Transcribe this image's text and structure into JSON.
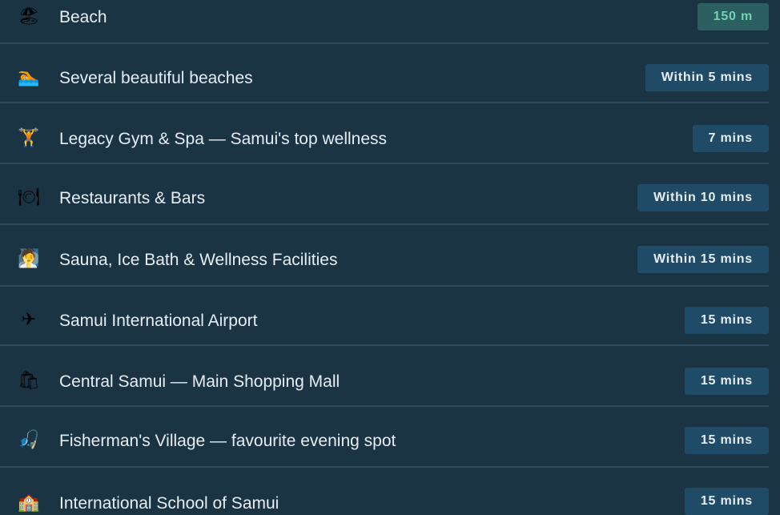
{
  "colors": {
    "background": "#1b3444",
    "divider": "#2c4a5a",
    "badge_default": "#1f4b66",
    "badge_accent": "#2b5f62",
    "badge_accent_text": "#6fd3b3",
    "text": "#e6eef3"
  },
  "items": [
    {
      "icon": "beach-icon",
      "glyph": "🏖",
      "label": "Beach",
      "distance": "150 m"
    },
    {
      "icon": "swimmer-icon",
      "glyph": "🏊",
      "label": "Several beautiful beaches",
      "distance": "Within 5 mins"
    },
    {
      "icon": "weightlifter-icon",
      "glyph": "🏋",
      "label": "Legacy Gym & Spa — Samui's top wellness",
      "distance": "7 mins"
    },
    {
      "icon": "fork-knife-plate-icon",
      "glyph": "🍽",
      "label": "Restaurants & Bars",
      "distance": "Within 10 mins"
    },
    {
      "icon": "person-in-steam-icon",
      "glyph": "🧖",
      "label": "Sauna, Ice Bath & Wellness Facilities",
      "distance": "Within 15 mins"
    },
    {
      "icon": "airplane-icon",
      "glyph": "✈",
      "label": "Samui International Airport",
      "distance": "15 mins"
    },
    {
      "icon": "shopping-bags-icon",
      "glyph": "🛍",
      "label": "Central Samui — Main Shopping Mall",
      "distance": "15 mins"
    },
    {
      "icon": "fishing-pole-icon",
      "glyph": "🎣",
      "label": "Fisherman's Village — favourite evening spot",
      "distance": "15 mins"
    },
    {
      "icon": "school-icon",
      "glyph": "🏫",
      "label": "International School of Samui",
      "distance": "15 mins"
    }
  ]
}
